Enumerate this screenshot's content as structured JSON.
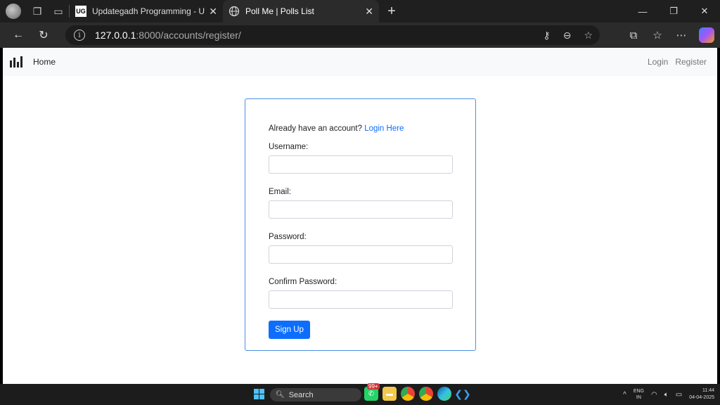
{
  "browser": {
    "tabs": [
      {
        "title": "Updategadh Programming - Upd",
        "favicon": "UG",
        "active": false
      },
      {
        "title": "Poll Me | Polls List",
        "favicon": "globe-icon",
        "active": true
      }
    ],
    "url_host": "127.0.0.1",
    "url_path": ":8000/accounts/register/"
  },
  "site": {
    "nav": {
      "home": "Home",
      "login": "Login",
      "register": "Register"
    },
    "form": {
      "already_text": "Already have an account?",
      "login_link": "Login Here",
      "username_label": "Username:",
      "email_label": "Email:",
      "password_label": "Password:",
      "confirm_label": "Confirm Password:",
      "submit_label": "Sign Up"
    }
  },
  "taskbar": {
    "search_placeholder": "Search",
    "badge": "99+",
    "lang_line1": "ENG",
    "lang_line2": "IN",
    "time": "11:44",
    "date": "04-04-2025"
  },
  "colors": {
    "primary": "#0d6efd",
    "card_border": "#4a90e2"
  }
}
